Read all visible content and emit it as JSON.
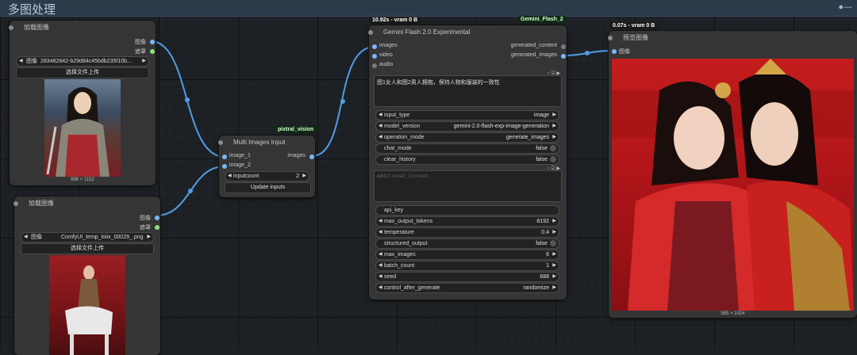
{
  "group": {
    "title": "多图处理"
  },
  "load1": {
    "title": "加载图像",
    "out_image": "图像",
    "out_mask": "遮罩",
    "image_label": "图像",
    "image_value": "283482842-b29d84c45bdb235f10b...",
    "upload_label": "选择文件上传",
    "size": "896 × 1152"
  },
  "load2": {
    "title": "加载图像",
    "out_image": "图像",
    "out_mask": "遮罩",
    "image_label": "图像",
    "image_value": "ComfyUI_temp_loiix_00029_.png",
    "upload_label": "选择文件上传"
  },
  "multi": {
    "badge": "pixtral_vision",
    "title": "Multi Images Input",
    "in1": "image_1",
    "in2": "image_2",
    "out": "images",
    "inputcount_label": "inputcount",
    "inputcount_value": "2",
    "update_label": "Update inputs"
  },
  "gemini": {
    "badge_time": "10.92s - vram 0 B",
    "badge_name": "Gemini_Flash_2",
    "title": "Gemini Flash 2.0 Experimental",
    "inputs": [
      "images",
      "video",
      "audio"
    ],
    "outputs": [
      "generated_content",
      "generated_images"
    ],
    "prompt": "图1女人和图2男人拥抱，保持人物和服装的一致性",
    "additional_placeholder": "Additional_Context",
    "widgets1": [
      {
        "label": "input_type",
        "value": "image"
      },
      {
        "label": "model_version",
        "value": "gemini-2.0-flash-exp-image-generation"
      },
      {
        "label": "operation_mode",
        "value": "generate_images"
      },
      {
        "label": "chat_mode",
        "value": "false"
      },
      {
        "label": "clear_history",
        "value": "false"
      }
    ],
    "widgets2": [
      {
        "label": "api_key",
        "value": ""
      },
      {
        "label": "max_output_tokens",
        "value": "8192"
      },
      {
        "label": "temperature",
        "value": "0.4"
      },
      {
        "label": "structured_output",
        "value": "false"
      },
      {
        "label": "max_images",
        "value": "6"
      },
      {
        "label": "batch_count",
        "value": "1"
      },
      {
        "label": "seed",
        "value": "688"
      },
      {
        "label": "control_after_generate",
        "value": "randomize"
      }
    ]
  },
  "preview": {
    "badge_time": "0.07s - vram 0 B",
    "title": "预览图像",
    "in_image": "图像",
    "size": "985 × 1024"
  }
}
